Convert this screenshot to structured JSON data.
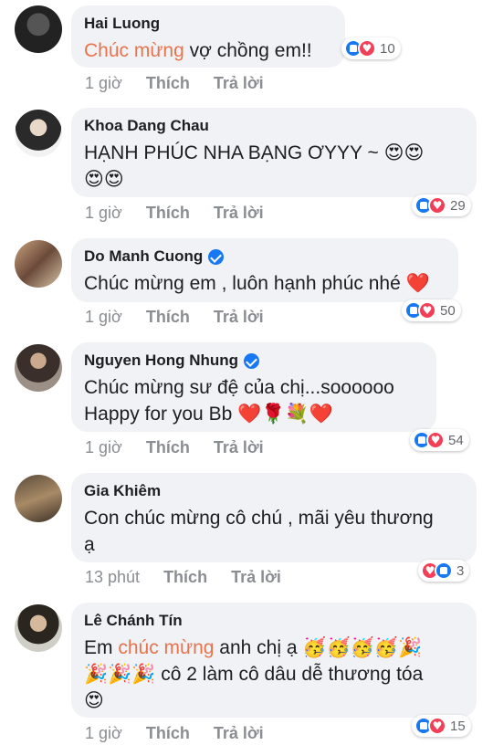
{
  "comments": [
    {
      "name": "Hai Luong",
      "verified": false,
      "text_pre": "",
      "text_highlight": "Chúc mừng",
      "text_post": " vợ chồng em!!",
      "time": "1 giờ",
      "like": "Thích",
      "reply": "Trả lời",
      "reaction_count": "10"
    },
    {
      "name": "Khoa Dang Chau",
      "verified": false,
      "text_line1": "HẠNH PHÚC NHA BẠNG ƠYYY ~ 😍😍",
      "text_line2": "😍😍",
      "time": "1 giờ",
      "like": "Thích",
      "reply": "Trả lời",
      "reaction_count": "29"
    },
    {
      "name": "Do Manh Cuong",
      "verified": true,
      "text_line1": "Chúc mừng em , luôn hạnh phúc nhé ❤️",
      "time": "1 giờ",
      "like": "Thích",
      "reply": "Trả lời",
      "reaction_count": "50"
    },
    {
      "name": "Nguyen Hong Nhung",
      "verified": true,
      "text_line1": "Chúc mừng sư đệ của chị...soooooo",
      "text_line2": "Happy for you Bb ❤️🌹💐❤️",
      "time": "1 giờ",
      "like": "Thích",
      "reply": "Trả lời",
      "reaction_count": "54"
    },
    {
      "name": "Gia Khiêm",
      "verified": false,
      "text_line1": "Con chúc mừng cô chú , mãi yêu thương",
      "text_line2": "ạ",
      "time": "13 phút",
      "like": "Thích",
      "reply": "Trả lời",
      "reaction_count": "3"
    },
    {
      "name": "Lê Chánh Tín",
      "verified": false,
      "text_pre": "Em ",
      "text_highlight": "chúc mừng",
      "text_post": " anh chị ạ 🥳🥳🥳🥳🎉",
      "text_line2": "🎉🎉🎉 cô 2 làm cô dâu dễ thương tóa",
      "text_line3": "😍",
      "time": "1 giờ",
      "like": "Thích",
      "reply": "Trả lời",
      "reaction_count": "15"
    }
  ],
  "colors": {
    "bubble": "#f0f2f5",
    "highlight": "#e9734d",
    "like_blue": "#1877f2",
    "love_red": "#f33e58",
    "meta_gray": "#8a8d91"
  }
}
